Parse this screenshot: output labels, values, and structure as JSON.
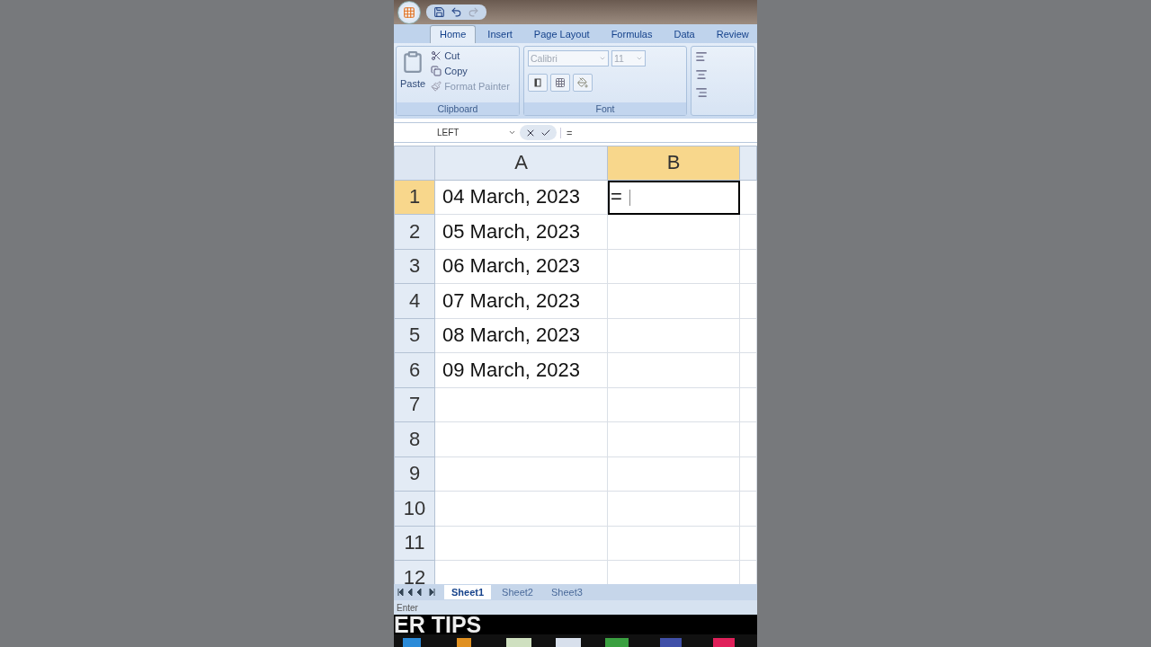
{
  "ribbon_tabs": [
    {
      "label": "Home",
      "selected": true
    },
    {
      "label": "Insert",
      "selected": false
    },
    {
      "label": "Page Layout",
      "selected": false
    },
    {
      "label": "Formulas",
      "selected": false
    },
    {
      "label": "Data",
      "selected": false
    },
    {
      "label": "Review",
      "selected": false
    }
  ],
  "clipboard": {
    "paste": "Paste",
    "cut": "Cut",
    "copy": "Copy",
    "format_painter": "Format Painter",
    "group": "Clipboard"
  },
  "font": {
    "name": "Calibri",
    "size": "11",
    "disabled": true,
    "group": "Font"
  },
  "formula_bar": {
    "name_box": "LEFT",
    "formula": "="
  },
  "columns": [
    {
      "label": "A",
      "selected": false
    },
    {
      "label": "B",
      "selected": true
    }
  ],
  "rows": [
    {
      "number": "1",
      "selected": true,
      "cells": [
        "04 March, 2023",
        "="
      ]
    },
    {
      "number": "2",
      "selected": false,
      "cells": [
        "05 March, 2023",
        ""
      ]
    },
    {
      "number": "3",
      "selected": false,
      "cells": [
        "06 March, 2023",
        ""
      ]
    },
    {
      "number": "4",
      "selected": false,
      "cells": [
        "07 March, 2023",
        ""
      ]
    },
    {
      "number": "5",
      "selected": false,
      "cells": [
        "08 March, 2023",
        ""
      ]
    },
    {
      "number": "6",
      "selected": false,
      "cells": [
        "09 March, 2023",
        ""
      ]
    },
    {
      "number": "7",
      "selected": false,
      "cells": [
        "",
        ""
      ]
    },
    {
      "number": "8",
      "selected": false,
      "cells": [
        "",
        ""
      ]
    },
    {
      "number": "9",
      "selected": false,
      "cells": [
        "",
        ""
      ]
    },
    {
      "number": "10",
      "selected": false,
      "cells": [
        "",
        ""
      ]
    },
    {
      "number": "11",
      "selected": false,
      "cells": [
        "",
        ""
      ]
    },
    {
      "number": "12",
      "selected": false,
      "cells": [
        "",
        ""
      ]
    }
  ],
  "sheets": [
    {
      "label": "Sheet1",
      "selected": true
    },
    {
      "label": "Sheet2",
      "selected": false
    },
    {
      "label": "Sheet3",
      "selected": false
    }
  ],
  "status": "Enter",
  "caption": "ER TIPS"
}
